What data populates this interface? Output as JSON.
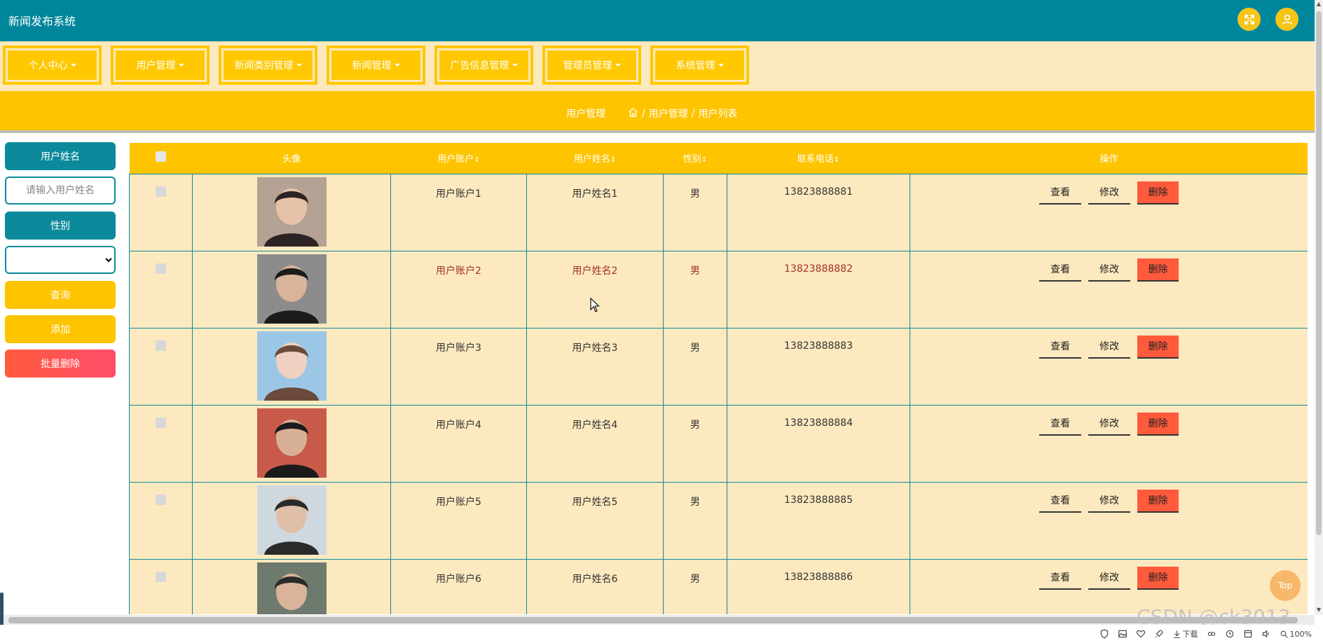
{
  "header": {
    "title": "新闻发布系统",
    "icons": [
      "fullscreen-icon",
      "user-icon"
    ]
  },
  "nav": {
    "items": [
      {
        "label": "个人中心"
      },
      {
        "label": "用户管理"
      },
      {
        "label": "新闻类别管理"
      },
      {
        "label": "新闻管理"
      },
      {
        "label": "广告信息管理"
      },
      {
        "label": "管理员管理"
      },
      {
        "label": "系统管理"
      }
    ]
  },
  "breadcrumb": {
    "title": "用户管理",
    "path": [
      "用户管理",
      "用户列表"
    ],
    "separator": "/"
  },
  "filters": {
    "name_label": "用户姓名",
    "name_placeholder": "请输入用户姓名",
    "gender_label": "性别",
    "gender_selected": "",
    "search_button": "查询",
    "add_button": "添加",
    "batch_delete_button": "批量删除"
  },
  "table": {
    "columns": {
      "avatar": "头像",
      "account": "用户账户",
      "name": "用户姓名",
      "gender": "性别",
      "phone": "联系电话",
      "actions": "操作"
    },
    "sort_glyph": "⇕",
    "action_labels": {
      "view": "查看",
      "edit": "修改",
      "delete": "删除"
    },
    "rows": [
      {
        "account": "用户账户1",
        "name": "用户姓名1",
        "gender": "男",
        "phone": "13823888881"
      },
      {
        "account": "用户账户2",
        "name": "用户姓名2",
        "gender": "男",
        "phone": "13823888882"
      },
      {
        "account": "用户账户3",
        "name": "用户姓名3",
        "gender": "男",
        "phone": "13823888883"
      },
      {
        "account": "用户账户4",
        "name": "用户姓名4",
        "gender": "男",
        "phone": "13823888884"
      },
      {
        "account": "用户账户5",
        "name": "用户姓名5",
        "gender": "男",
        "phone": "13823888885"
      },
      {
        "account": "用户账户6",
        "name": "用户姓名6",
        "gender": "男",
        "phone": "13823888886"
      }
    ]
  },
  "back_to_top": "Top",
  "watermark": "CSDN @ck3013",
  "statusbar": {
    "download_label": "下载",
    "zoom": "100%"
  },
  "colors": {
    "teal": "#00869b",
    "yellow": "#ffc400",
    "cream": "#fde9bf",
    "danger": "#ff5a3c"
  }
}
